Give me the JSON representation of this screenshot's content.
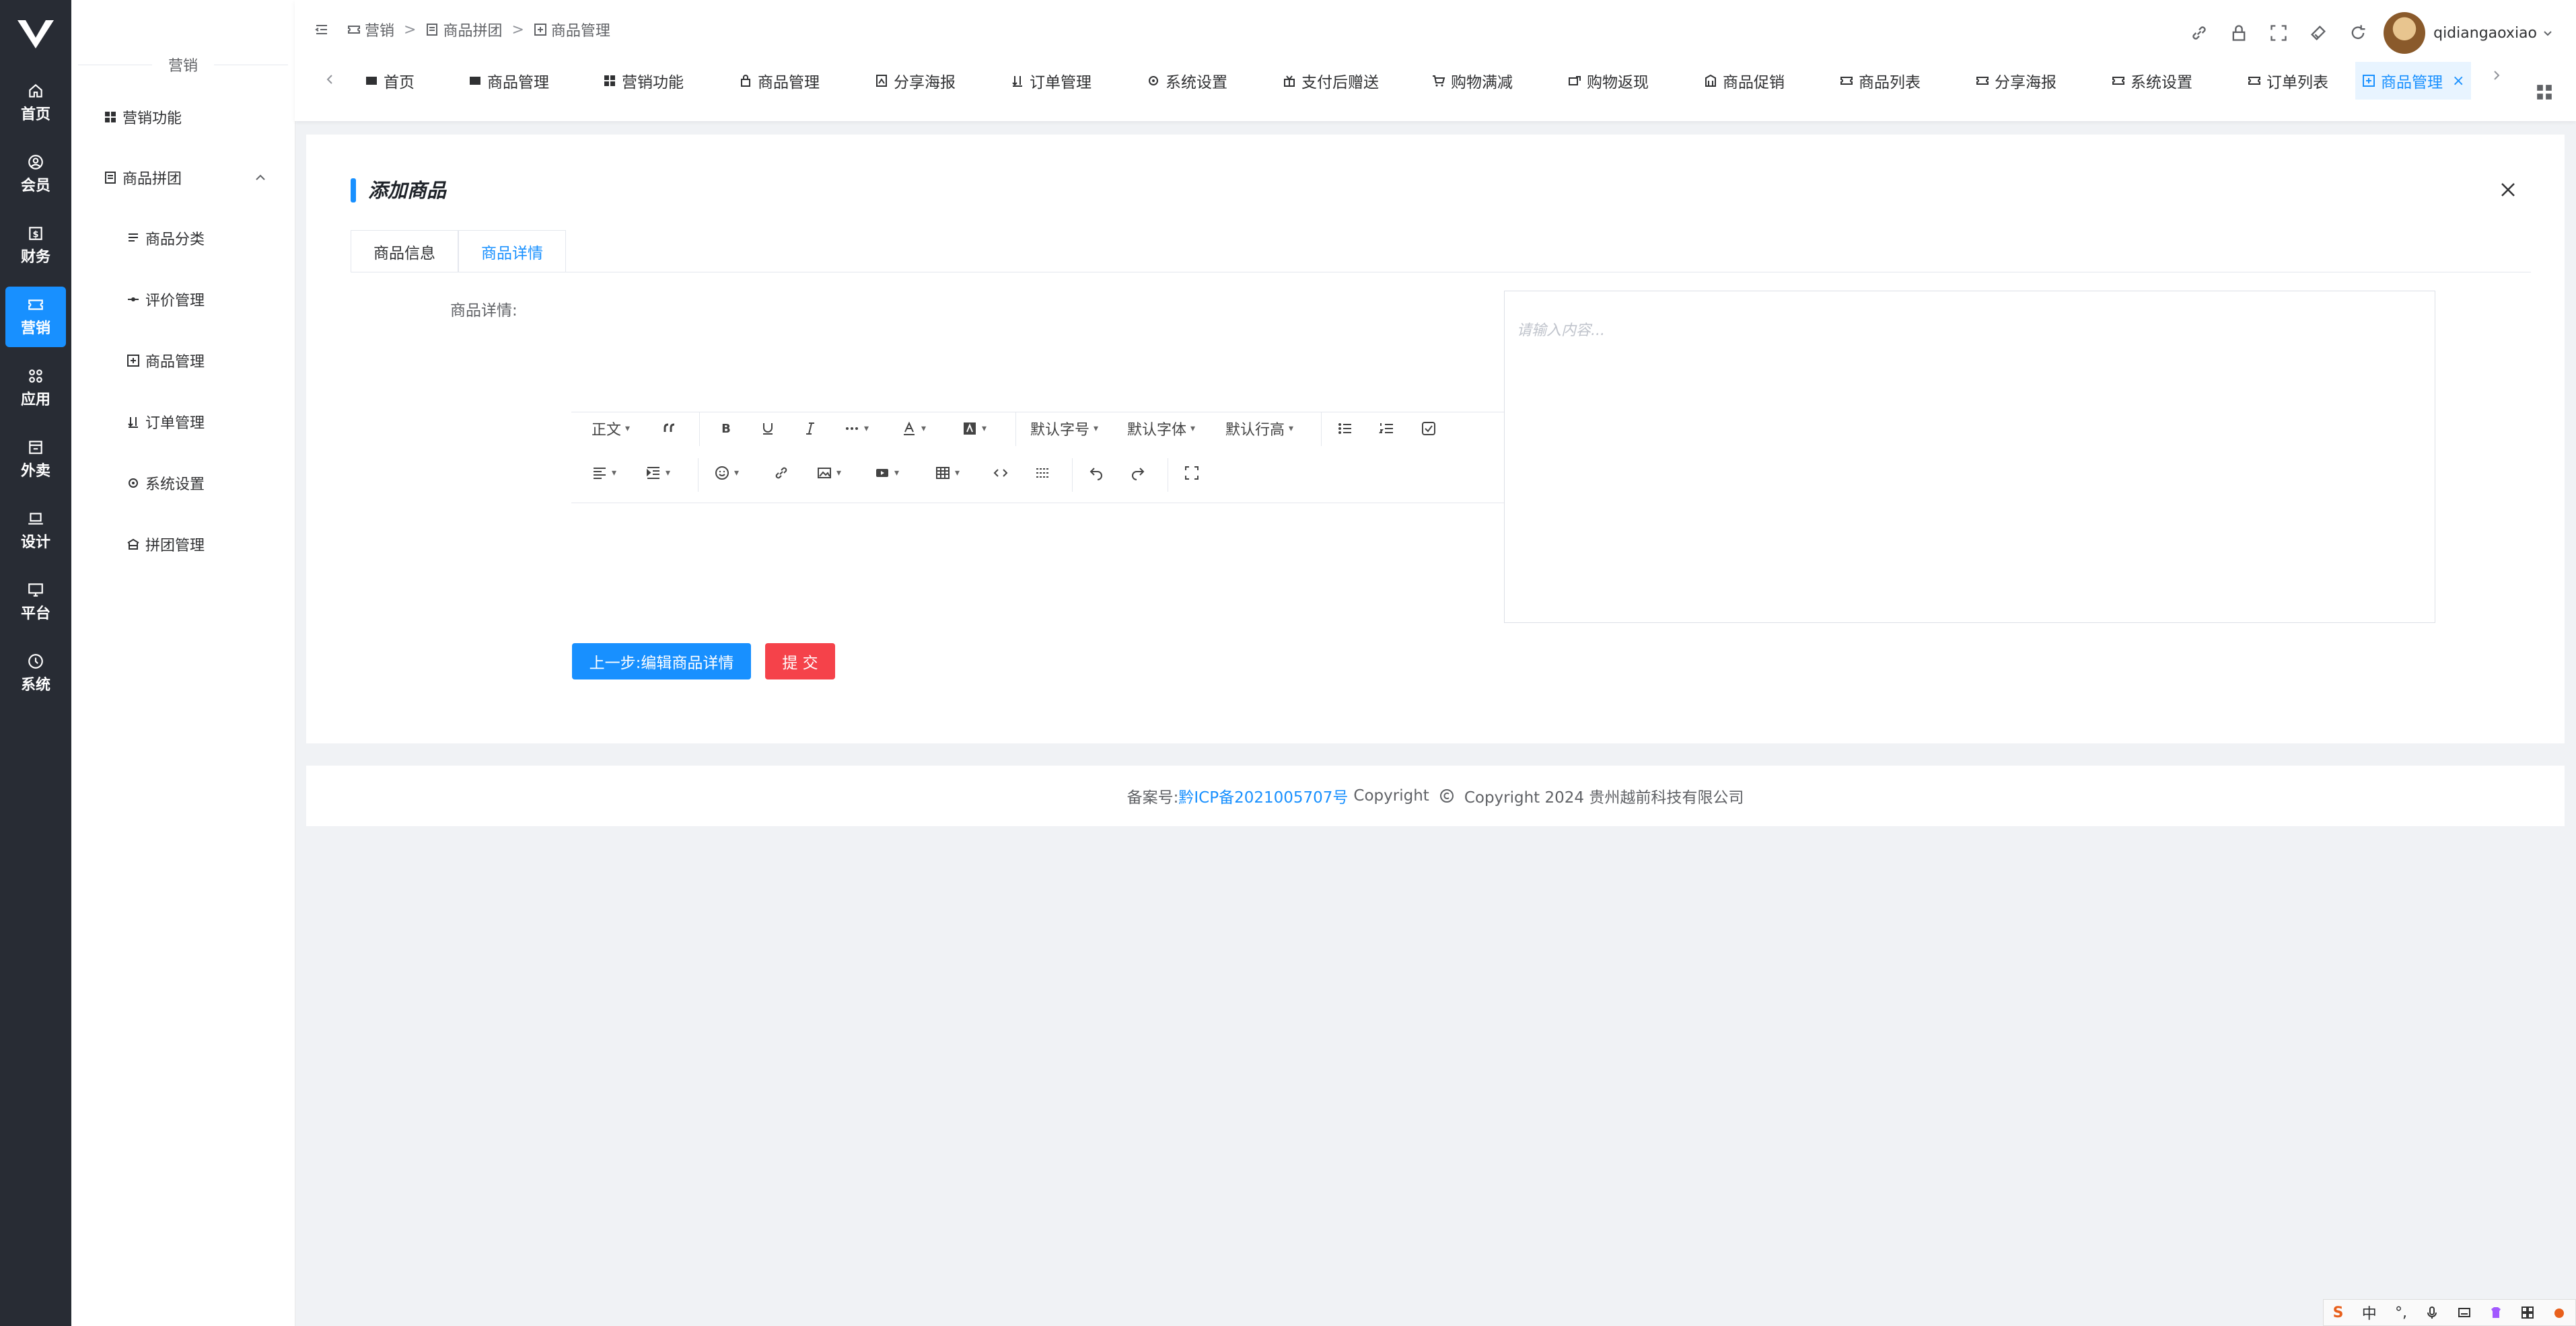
{
  "rail": {
    "items": [
      {
        "label": "首页"
      },
      {
        "label": "会员"
      },
      {
        "label": "财务"
      },
      {
        "label": "营销"
      },
      {
        "label": "应用"
      },
      {
        "label": "外卖"
      },
      {
        "label": "设计"
      },
      {
        "label": "平台"
      },
      {
        "label": "系统"
      }
    ],
    "active_index": 3,
    "active_color": "#1890ff",
    "background": "#282c34"
  },
  "submenu": {
    "heading": "营销",
    "items": [
      {
        "label": "营销功能",
        "icon": "grid-icon"
      },
      {
        "label": "商品拼团",
        "icon": "doc-icon",
        "expanded": true
      },
      {
        "label": "商品分类",
        "icon": "list-icon"
      },
      {
        "label": "评价管理",
        "icon": "dot-line-icon"
      },
      {
        "label": "商品管理",
        "icon": "plus-square-icon"
      },
      {
        "label": "订单管理",
        "icon": "sort-icon"
      },
      {
        "label": "系统设置",
        "icon": "gear-icon"
      },
      {
        "label": "拼团管理",
        "icon": "store-icon"
      }
    ]
  },
  "header": {
    "breadcrumb": [
      "营销",
      "商品拼团",
      "商品管理"
    ],
    "breadcrumb_separator": ">",
    "username": "qidiangaoxiao",
    "tools": [
      "link-icon",
      "lock-icon",
      "fullscreen-icon",
      "theme-icon",
      "refresh-icon"
    ]
  },
  "tabs": {
    "items": [
      {
        "label": "首页"
      },
      {
        "label": "商品管理"
      },
      {
        "label": "营销功能"
      },
      {
        "label": "商品管理"
      },
      {
        "label": "分享海报"
      },
      {
        "label": "订单管理"
      },
      {
        "label": "系统设置"
      },
      {
        "label": "支付后赠送"
      },
      {
        "label": "购物满减"
      },
      {
        "label": "购物返现"
      },
      {
        "label": "商品促销"
      },
      {
        "label": "商品列表"
      },
      {
        "label": "分享海报"
      },
      {
        "label": "系统设置"
      },
      {
        "label": "订单列表"
      },
      {
        "label": "商品管理",
        "active": true
      }
    ],
    "close_glyph": "×"
  },
  "card": {
    "title": "添加商品",
    "tabs": [
      {
        "label": "商品信息"
      },
      {
        "label": "商品详情",
        "active": true
      }
    ],
    "field_label": "商品详情:",
    "editor_placeholder": "请输入内容...",
    "toolbar": {
      "row1": {
        "paragraph": "正文",
        "font_size": "默认字号",
        "font_family": "默认字体",
        "line_height": "默认行高"
      }
    },
    "buttons": {
      "prev": "上一步:编辑商品详情",
      "submit": "提 交"
    }
  },
  "footer": {
    "prefix": "备案号:",
    "icp": "黔ICP备2021005707号",
    "copyright_word": "Copyright",
    "copyright_text": "Copyright 2024 贵州越前科技有限公司"
  },
  "ime": {
    "lang": "中"
  }
}
